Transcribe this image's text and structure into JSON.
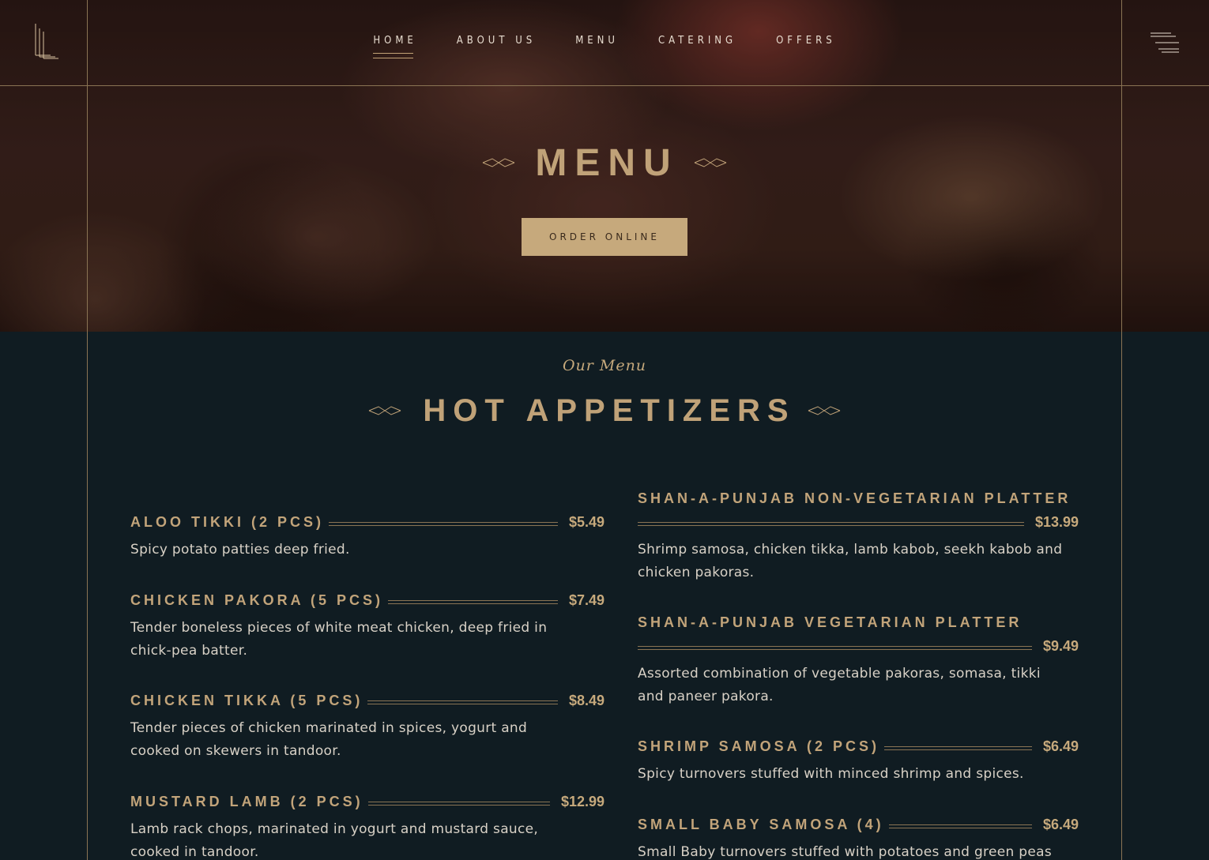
{
  "nav": {
    "items": [
      {
        "label": "HOME",
        "active": true
      },
      {
        "label": "ABOUT US",
        "active": false
      },
      {
        "label": "MENU",
        "active": false
      },
      {
        "label": "CATERING",
        "active": false
      },
      {
        "label": "OFFERS",
        "active": false
      }
    ]
  },
  "hero": {
    "title": "MENU",
    "order_button": "ORDER ONLINE"
  },
  "section": {
    "subtitle": "Our Menu",
    "title": "HOT APPETIZERS"
  },
  "menu_left": [
    {
      "name": "ALOO TIKKI (2 PCS)",
      "price": "$5.49",
      "desc": "Spicy potato patties deep fried."
    },
    {
      "name": "CHICKEN PAKORA (5 PCS)",
      "price": "$7.49",
      "desc": "Tender boneless pieces of white meat chicken, deep fried in chick-pea batter."
    },
    {
      "name": "CHICKEN TIKKA (5 PCS)",
      "price": "$8.49",
      "desc": "Tender pieces of chicken marinated in spices, yogurt and cooked on skewers in tandoor."
    },
    {
      "name": "MUSTARD LAMB (2 PCS)",
      "price": "$12.99",
      "desc": "Lamb rack chops, marinated in yogurt and mustard sauce, cooked in tandoor."
    }
  ],
  "menu_right": [
    {
      "name": "SHAN-A-PUNJAB NON-VEGETARIAN PLATTER",
      "price": "$13.99",
      "desc": "Shrimp samosa, chicken tikka, lamb kabob, seekh kabob and chicken pakoras."
    },
    {
      "name": "SHAN-A-PUNJAB VEGETARIAN PLATTER",
      "price": "$9.49",
      "desc": "Assorted combination of vegetable pakoras, somasa, tikki and paneer pakora."
    },
    {
      "name": "SHRIMP SAMOSA (2 PCS)",
      "price": "$6.49",
      "desc": "Spicy turnovers stuffed with minced shrimp and spices."
    },
    {
      "name": "SMALL BABY SAMOSA (4)",
      "price": "$6.49",
      "desc": "Small Baby turnovers stuffed with potatoes and green peas"
    }
  ],
  "colors": {
    "accent": "#c6a97c",
    "background": "#101c22",
    "line": "#8a7454"
  }
}
